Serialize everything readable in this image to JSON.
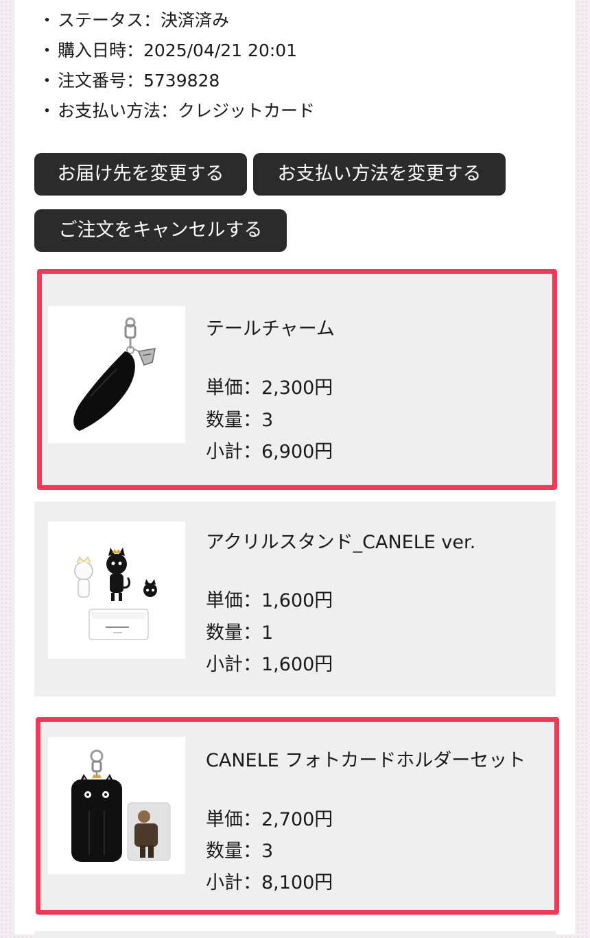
{
  "order": {
    "status_text": "ステータス：決済済み",
    "purchased_text": "購入日時：2025/04/21 20:01",
    "order_no_text": "注文番号：5739828",
    "payment_text": "お支払い方法：クレジットカード"
  },
  "bullet": "・",
  "actions": {
    "change_address": "お届け先を変更する",
    "change_payment": "お支払い方法を変更する",
    "cancel_order": "ご注文をキャンセルする"
  },
  "colors": {
    "highlight": "#f13a59",
    "button": "#2b2b2b",
    "card": "#efefef"
  },
  "items": [
    {
      "name": "テールチャーム",
      "unit_price": "単価：2,300円",
      "quantity": "数量：3",
      "subtotal": "小計：6,900円",
      "icon": "tail-charm-image",
      "highlighted": true
    },
    {
      "name": "アクリルスタンド_CANELE ver.",
      "unit_price": "単価：1,600円",
      "quantity": "数量：1",
      "subtotal": "小計：1,600円",
      "icon": "acrylic-stand-image",
      "highlighted": false
    },
    {
      "name": "CANELE フォトカードホルダーセット",
      "unit_price": "単価：2,700円",
      "quantity": "数量：3",
      "subtotal": "小計：8,100円",
      "icon": "photo-card-holder-image",
      "highlighted": true
    }
  ]
}
